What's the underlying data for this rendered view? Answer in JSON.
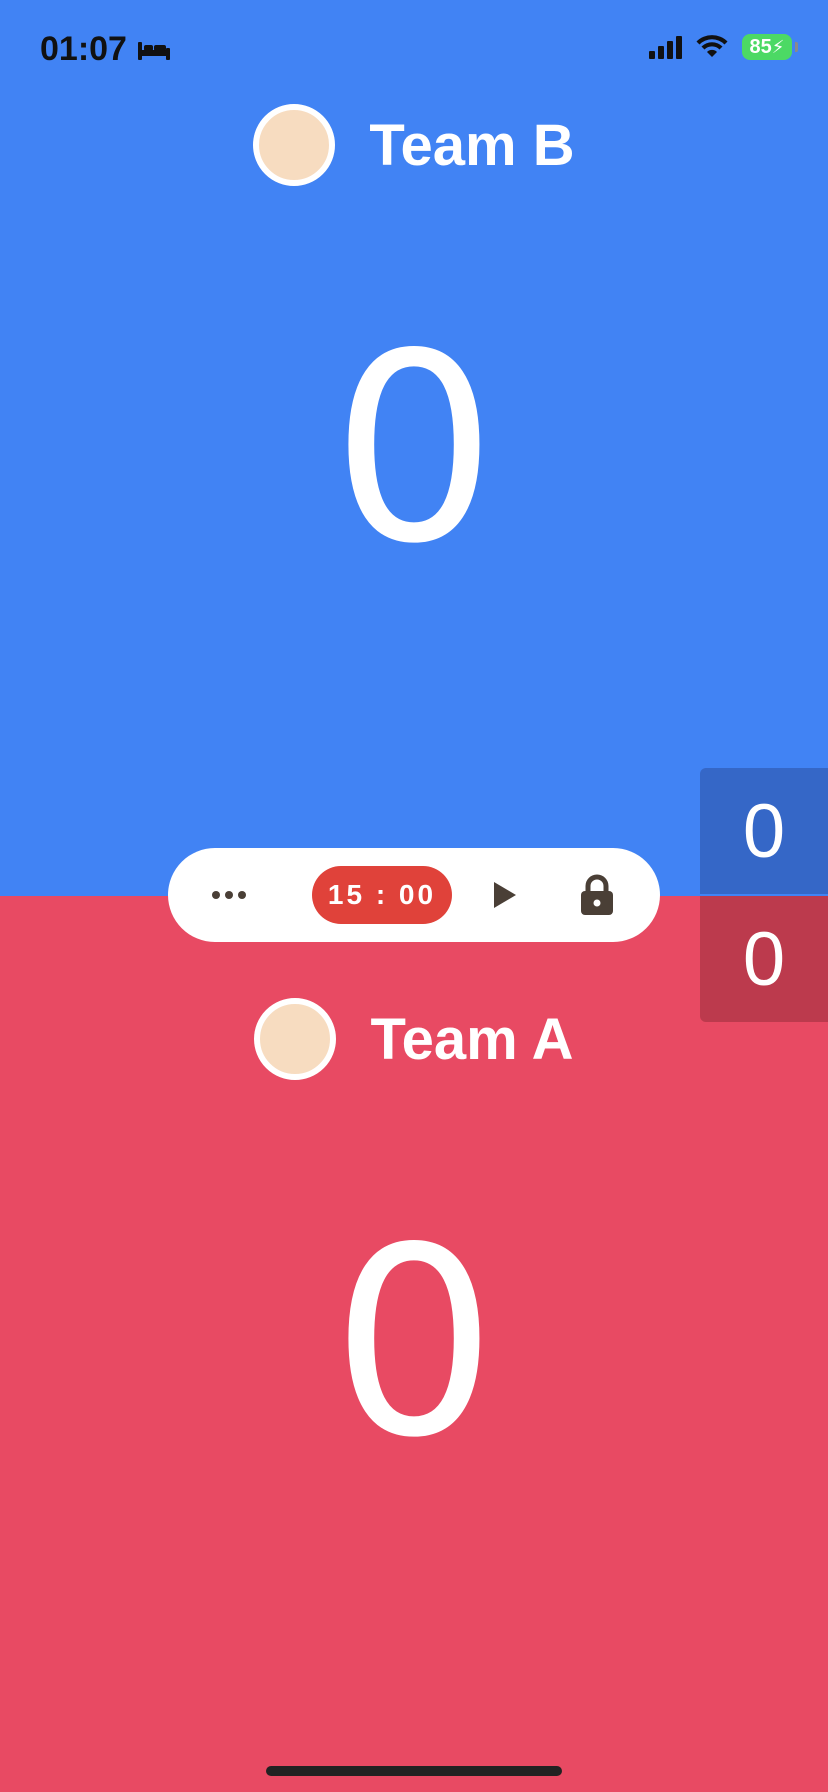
{
  "status_bar": {
    "time": "01:07",
    "battery": "85"
  },
  "team_b": {
    "name": "Team B",
    "score": "0",
    "color": "#4183f4",
    "avatar_color": "#f7dcc0"
  },
  "team_a": {
    "name": "Team A",
    "score": "0",
    "color": "#e84a63",
    "avatar_color": "#f7dcc0"
  },
  "mini_scoreboard": {
    "team_b_score": "0",
    "team_a_score": "0",
    "team_b_color": "#3567c7",
    "team_a_color": "#bc3a4d"
  },
  "controls": {
    "timer": "15 : 00",
    "timer_color": "#e0423a",
    "icon_color": "#4a3f36"
  },
  "icons": [
    "bed-icon",
    "signal-icon",
    "wifi-icon",
    "battery-icon",
    "more-icon",
    "play-icon",
    "lock-icon"
  ]
}
